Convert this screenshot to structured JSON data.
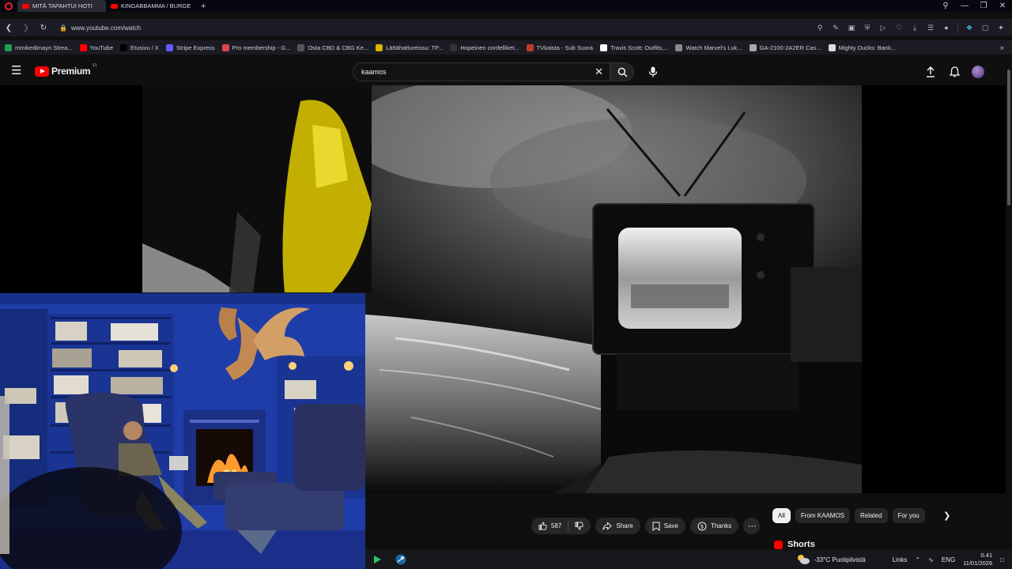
{
  "browser": {
    "tabs": [
      {
        "label": "MITÄ TAPAHTUI HOTI"
      },
      {
        "label": "KINGABBAMMA / BURGE"
      }
    ],
    "url": "www.youtube.com/watch",
    "bookmarks": [
      {
        "label": "mmikedimayn Strea...",
        "icon_color": "#1ea04a"
      },
      {
        "label": "YouTube",
        "icon_color": "#ff0000"
      },
      {
        "label": "Etusivu / X",
        "icon_color": "#000000"
      },
      {
        "label": "Stripe Express",
        "icon_color": "#635bff"
      },
      {
        "label": "Pro membership - G...",
        "icon_color": "#e0424f"
      },
      {
        "label": "Osta CBD & CBG Ke...",
        "icon_color": "#555555"
      },
      {
        "label": "Lättähattureissu: TP...",
        "icon_color": "#d8b400"
      },
      {
        "label": "Hopeinen cordelliket...",
        "icon_color": "#333333"
      },
      {
        "label": "TVkaista - Sub Suora",
        "icon_color": "#c0392b"
      },
      {
        "label": "Travis Scott: Outfits,...",
        "icon_color": "#ffffff"
      },
      {
        "label": "Watch Marvel's Luk...",
        "icon_color": "#888888"
      },
      {
        "label": "GA-2100-2A2ER Cas...",
        "icon_color": "#aaaaaa"
      },
      {
        "label": "Mighty Ducks: Bank...",
        "icon_color": "#dddddd"
      }
    ]
  },
  "youtube": {
    "logo_text": "Premium",
    "logo_sup": "FI",
    "search": {
      "value": "kaamos"
    },
    "actions": {
      "like_count": "587",
      "share_label": "Share",
      "save_label": "Save",
      "thanks_label": "Thanks"
    },
    "chips": [
      {
        "label": "All",
        "selected": true
      },
      {
        "label": "From KAAMOS",
        "selected": false
      },
      {
        "label": "Related",
        "selected": false
      },
      {
        "label": "For you",
        "selected": false
      }
    ],
    "shorts_label": "Shorts"
  },
  "taskbar": {
    "weather": "-33°C  Puolipilvistä",
    "links_label": "Links",
    "lang": "ENG",
    "time": "0.41",
    "date": "11/01/2026"
  },
  "colors": {
    "yt_red": "#ff0000",
    "bg": "#0f0f0f",
    "chip_bg": "#272727",
    "room_blue": "#1f3da8"
  }
}
